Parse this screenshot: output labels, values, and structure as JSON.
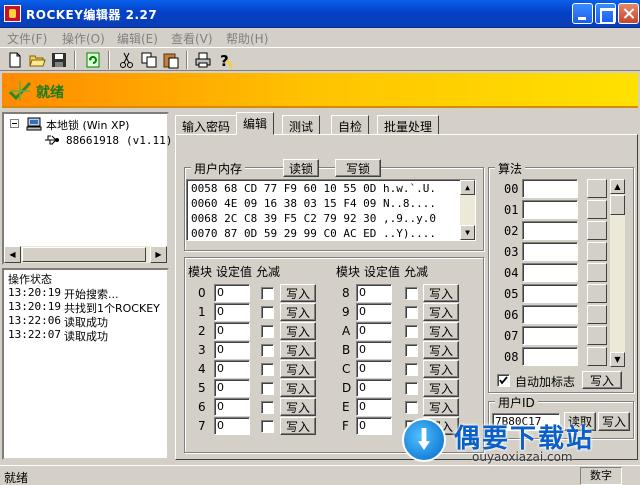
{
  "window": {
    "title": "ROCKEY编辑器 2.27"
  },
  "menu": [
    "文件(F)",
    "操作(O)",
    "编辑(E)",
    "查看(V)",
    "帮助(H)"
  ],
  "toolbar_icons": [
    "new-icon",
    "open-icon",
    "save-icon",
    "refresh-icon",
    "cut-icon",
    "copy-icon",
    "paste-icon",
    "print-icon",
    "help-icon"
  ],
  "banner": {
    "status": "就绪",
    "accent": "#ffa500"
  },
  "tree": {
    "root": "本地锁 (Win XP)",
    "device_id": "88661918",
    "device_version": "(v1.11)"
  },
  "log": {
    "header": "操作状态",
    "lines": [
      {
        "time": "13:20:19",
        "text": "开始搜索..."
      },
      {
        "time": "13:20:19",
        "text": "共找到1个ROCKEY"
      },
      {
        "time": "13:22:06",
        "text": "读取成功"
      },
      {
        "time": "13:22:07",
        "text": "读取成功"
      }
    ]
  },
  "tabs": [
    "输入密码",
    "编辑",
    "测试",
    "自检",
    "批量处理"
  ],
  "user_memory": {
    "title": "用户内存",
    "read_label": "读锁",
    "write_label": "写锁",
    "lines": [
      "0058 68 CD 77 F9 60 10 55 0D h.w.`.U.",
      "0060 4E 09 16 38 03 15 F4 09 N..8....",
      "0068 2C C8 39 F5 C2 79 92 30 ,.9..y.0",
      "0070 87 0D 59 29 99 C0 AC ED ..Y)...."
    ]
  },
  "modules": {
    "headers": {
      "module": "模块",
      "value": "设定值",
      "allow": "允减"
    },
    "write_label": "写入",
    "left": [
      {
        "id": "0",
        "value": "0"
      },
      {
        "id": "1",
        "value": "0"
      },
      {
        "id": "2",
        "value": "0"
      },
      {
        "id": "3",
        "value": "0"
      },
      {
        "id": "4",
        "value": "0"
      },
      {
        "id": "5",
        "value": "0"
      },
      {
        "id": "6",
        "value": "0"
      },
      {
        "id": "7",
        "value": "0"
      }
    ],
    "right": [
      {
        "id": "8",
        "value": "0"
      },
      {
        "id": "9",
        "value": "0"
      },
      {
        "id": "A",
        "value": "0"
      },
      {
        "id": "B",
        "value": "0"
      },
      {
        "id": "C",
        "value": "0"
      },
      {
        "id": "D",
        "value": "0"
      },
      {
        "id": "E",
        "value": "0"
      },
      {
        "id": "F",
        "value": "0"
      }
    ]
  },
  "algorithm": {
    "title": "算法",
    "rows": [
      "00",
      "01",
      "02",
      "03",
      "04",
      "05",
      "06",
      "07",
      "08"
    ],
    "auto_flag_label": "自动加标志",
    "auto_flag_checked": true,
    "write_label": "写入"
  },
  "user_id": {
    "title": "用户ID",
    "value": "7B80C17",
    "read_label": "读取",
    "write_label": "写入"
  },
  "statusbar": {
    "text": "就绪",
    "numlock": "数字"
  },
  "watermark": {
    "title": "偶要下载站",
    "url": "ouyaoxiazai.com"
  }
}
